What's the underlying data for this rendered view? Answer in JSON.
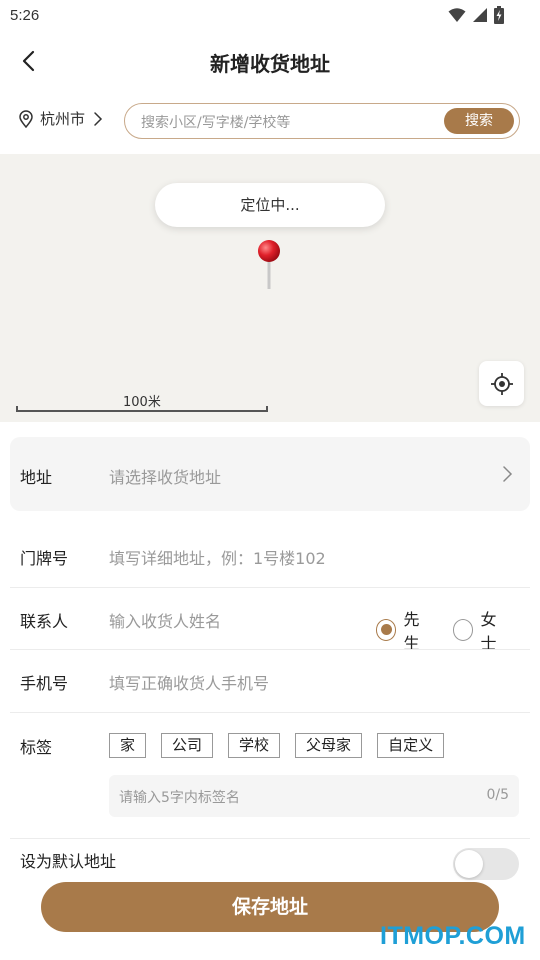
{
  "status_bar": {
    "time": "5:26"
  },
  "nav": {
    "title": "新增收货地址"
  },
  "search": {
    "city": "杭州市",
    "placeholder": "搜索小区/写字楼/学校等",
    "button": "搜索"
  },
  "map": {
    "locating_text": "定位中...",
    "scale_label": "100米"
  },
  "form": {
    "address": {
      "label": "地址",
      "placeholder": "请选择收货地址"
    },
    "door": {
      "label": "门牌号",
      "placeholder": "填写详细地址，例：1号楼102"
    },
    "contact": {
      "label": "联系人",
      "placeholder": "输入收货人姓名",
      "options": [
        {
          "label": "先生",
          "selected": true
        },
        {
          "label": "女士",
          "selected": false
        }
      ]
    },
    "phone": {
      "label": "手机号",
      "placeholder": "填写正确收货人手机号"
    },
    "tags": {
      "label": "标签",
      "items": [
        "家",
        "公司",
        "学校",
        "父母家",
        "自定义"
      ],
      "input_placeholder": "请输入5字内标签名",
      "counter": "0/5"
    },
    "default": {
      "label": "设为默认地址",
      "enabled": false
    }
  },
  "save_button": "保存地址",
  "watermark": "ITMOP.COM",
  "colors": {
    "accent": "#a87a4a",
    "watermark": "#1f9fd6",
    "pin": "#e0202a"
  }
}
